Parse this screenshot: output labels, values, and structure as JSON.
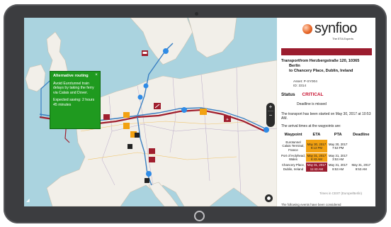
{
  "colors": {
    "accent_red": "#9b1c2e",
    "critical": "#c8102e",
    "eta_orange": "#f2a111",
    "alert_green": "#1f9a1f",
    "route_blue": "#3a7fc2"
  },
  "map": {
    "alert": {
      "title": "Alternative routing",
      "body": "Avoid Eurotunnel train delays by taking the ferry via Calais and Dover.",
      "saving": "Expected saving: 2 hours 45 minutes",
      "close_icon": "close-icon"
    },
    "zoom_in": "+",
    "zoom_out": "−",
    "icons": [
      "truck-icon",
      "ferry-icon",
      "train-icon",
      "plane-icon",
      "location-pin-icon"
    ]
  },
  "panel": {
    "brand": "synfioo",
    "tagline": "The ETA Experts",
    "transport_line1": "Transportfrom Herzbergstraße 120, 10365",
    "transport_line2": "Berlin",
    "transport_line3": "to Chancery Place, Dublin, Ireland",
    "asset": "Asset: P-SY004",
    "id": "ID: 3314",
    "status_label": "Status",
    "status_value": "CRITICAL",
    "deadline_note": "Deadline is missed",
    "started_note": "The transport has been started on May 30, 2017 at 10:53 AM.",
    "arrival_note": "The arrival times at the waypoints are:",
    "columns": [
      "Waypoint",
      "ETA",
      "PTA",
      "Deadline"
    ],
    "rows": [
      {
        "waypoint": "Eurotunnel Calais Terminal, France",
        "eta": "May 30, 2017 9:13 PM",
        "pta": "May 30, 2017 7:53 PM",
        "deadline": "",
        "eta_status": "late"
      },
      {
        "waypoint": "Port of Holyhead, Wales",
        "eta": "May 31, 2017 6:43 AM",
        "pta": "May 31, 2017 3:53 AM",
        "deadline": "",
        "eta_status": "late"
      },
      {
        "waypoint": "Chancery Place, Dublin, Ireland",
        "eta": "May 31, 2017 11:43 AM",
        "pta": "May 31, 2017 8:53 AM",
        "deadline": "May 31, 2017 9:53 AM",
        "eta_status": "missed"
      }
    ],
    "timezone_note": "Times in CEST (Europe/Berlin)",
    "events_note": "The following events have been considered"
  }
}
